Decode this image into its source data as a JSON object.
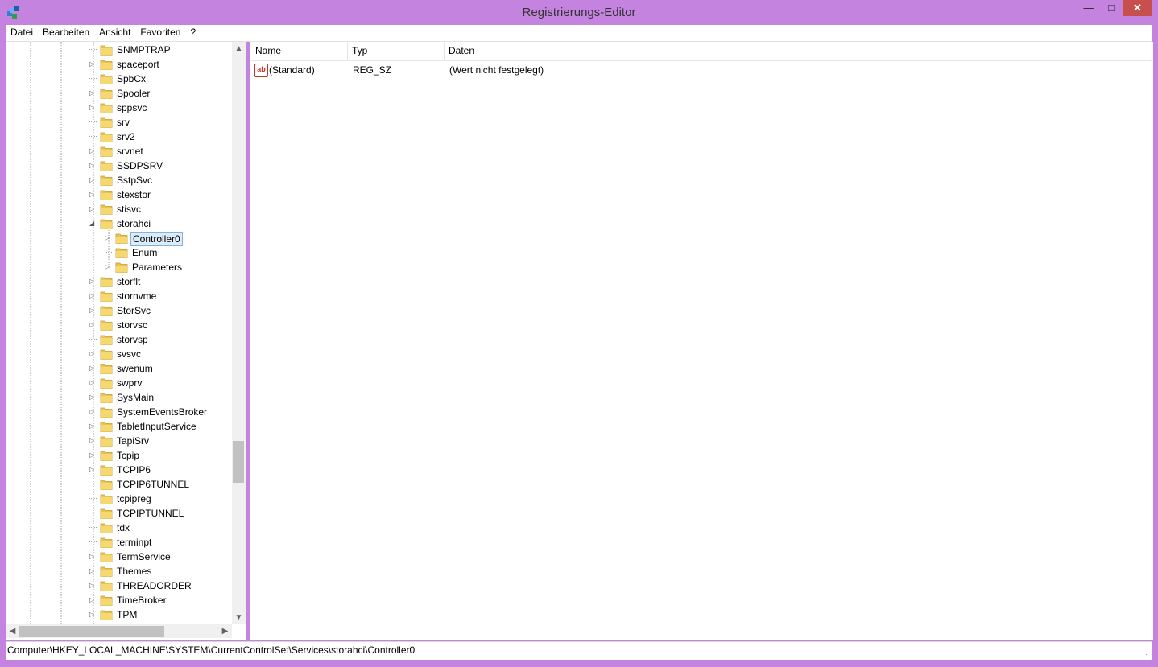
{
  "window": {
    "title": "Registrierungs-Editor",
    "min_glyph": "—",
    "max_glyph": "□",
    "close_glyph": "✕",
    "frame_color": "#c583e0"
  },
  "menu": [
    "Datei",
    "Bearbeiten",
    "Ansicht",
    "Favoriten",
    "?"
  ],
  "tree": [
    {
      "label": "SNMPTRAP",
      "level": 0,
      "expander": "none"
    },
    {
      "label": "spaceport",
      "level": 0,
      "expander": "collapsed"
    },
    {
      "label": "SpbCx",
      "level": 0,
      "expander": "none"
    },
    {
      "label": "Spooler",
      "level": 0,
      "expander": "collapsed"
    },
    {
      "label": "sppsvc",
      "level": 0,
      "expander": "collapsed"
    },
    {
      "label": "srv",
      "level": 0,
      "expander": "none"
    },
    {
      "label": "srv2",
      "level": 0,
      "expander": "none"
    },
    {
      "label": "srvnet",
      "level": 0,
      "expander": "collapsed"
    },
    {
      "label": "SSDPSRV",
      "level": 0,
      "expander": "collapsed"
    },
    {
      "label": "SstpSvc",
      "level": 0,
      "expander": "collapsed"
    },
    {
      "label": "stexstor",
      "level": 0,
      "expander": "collapsed"
    },
    {
      "label": "stisvc",
      "level": 0,
      "expander": "collapsed"
    },
    {
      "label": "storahci",
      "level": 0,
      "expander": "expanded"
    },
    {
      "label": "Controller0",
      "level": 1,
      "expander": "collapsed",
      "selected": true
    },
    {
      "label": "Enum",
      "level": 1,
      "expander": "none"
    },
    {
      "label": "Parameters",
      "level": 1,
      "expander": "collapsed"
    },
    {
      "label": "storflt",
      "level": 0,
      "expander": "collapsed"
    },
    {
      "label": "stornvme",
      "level": 0,
      "expander": "collapsed"
    },
    {
      "label": "StorSvc",
      "level": 0,
      "expander": "collapsed"
    },
    {
      "label": "storvsc",
      "level": 0,
      "expander": "collapsed"
    },
    {
      "label": "storvsp",
      "level": 0,
      "expander": "none"
    },
    {
      "label": "svsvc",
      "level": 0,
      "expander": "collapsed"
    },
    {
      "label": "swenum",
      "level": 0,
      "expander": "collapsed"
    },
    {
      "label": "swprv",
      "level": 0,
      "expander": "collapsed"
    },
    {
      "label": "SysMain",
      "level": 0,
      "expander": "collapsed"
    },
    {
      "label": "SystemEventsBroker",
      "level": 0,
      "expander": "collapsed"
    },
    {
      "label": "TabletInputService",
      "level": 0,
      "expander": "collapsed"
    },
    {
      "label": "TapiSrv",
      "level": 0,
      "expander": "collapsed"
    },
    {
      "label": "Tcpip",
      "level": 0,
      "expander": "collapsed"
    },
    {
      "label": "TCPIP6",
      "level": 0,
      "expander": "collapsed"
    },
    {
      "label": "TCPIP6TUNNEL",
      "level": 0,
      "expander": "none"
    },
    {
      "label": "tcpipreg",
      "level": 0,
      "expander": "none"
    },
    {
      "label": "TCPIPTUNNEL",
      "level": 0,
      "expander": "none"
    },
    {
      "label": "tdx",
      "level": 0,
      "expander": "none"
    },
    {
      "label": "terminpt",
      "level": 0,
      "expander": "none"
    },
    {
      "label": "TermService",
      "level": 0,
      "expander": "collapsed"
    },
    {
      "label": "Themes",
      "level": 0,
      "expander": "collapsed"
    },
    {
      "label": "THREADORDER",
      "level": 0,
      "expander": "collapsed"
    },
    {
      "label": "TimeBroker",
      "level": 0,
      "expander": "collapsed"
    },
    {
      "label": "TPM",
      "level": 0,
      "expander": "collapsed"
    }
  ],
  "list": {
    "columns": [
      "Name",
      "Typ",
      "Daten"
    ],
    "rows": [
      {
        "icon": "string-value-icon",
        "icon_text": "ab",
        "name": "(Standard)",
        "type": "REG_SZ",
        "data": "(Wert nicht festgelegt)"
      }
    ]
  },
  "status": {
    "path": "Computer\\HKEY_LOCAL_MACHINE\\SYSTEM\\CurrentControlSet\\Services\\storahci\\Controller0"
  }
}
